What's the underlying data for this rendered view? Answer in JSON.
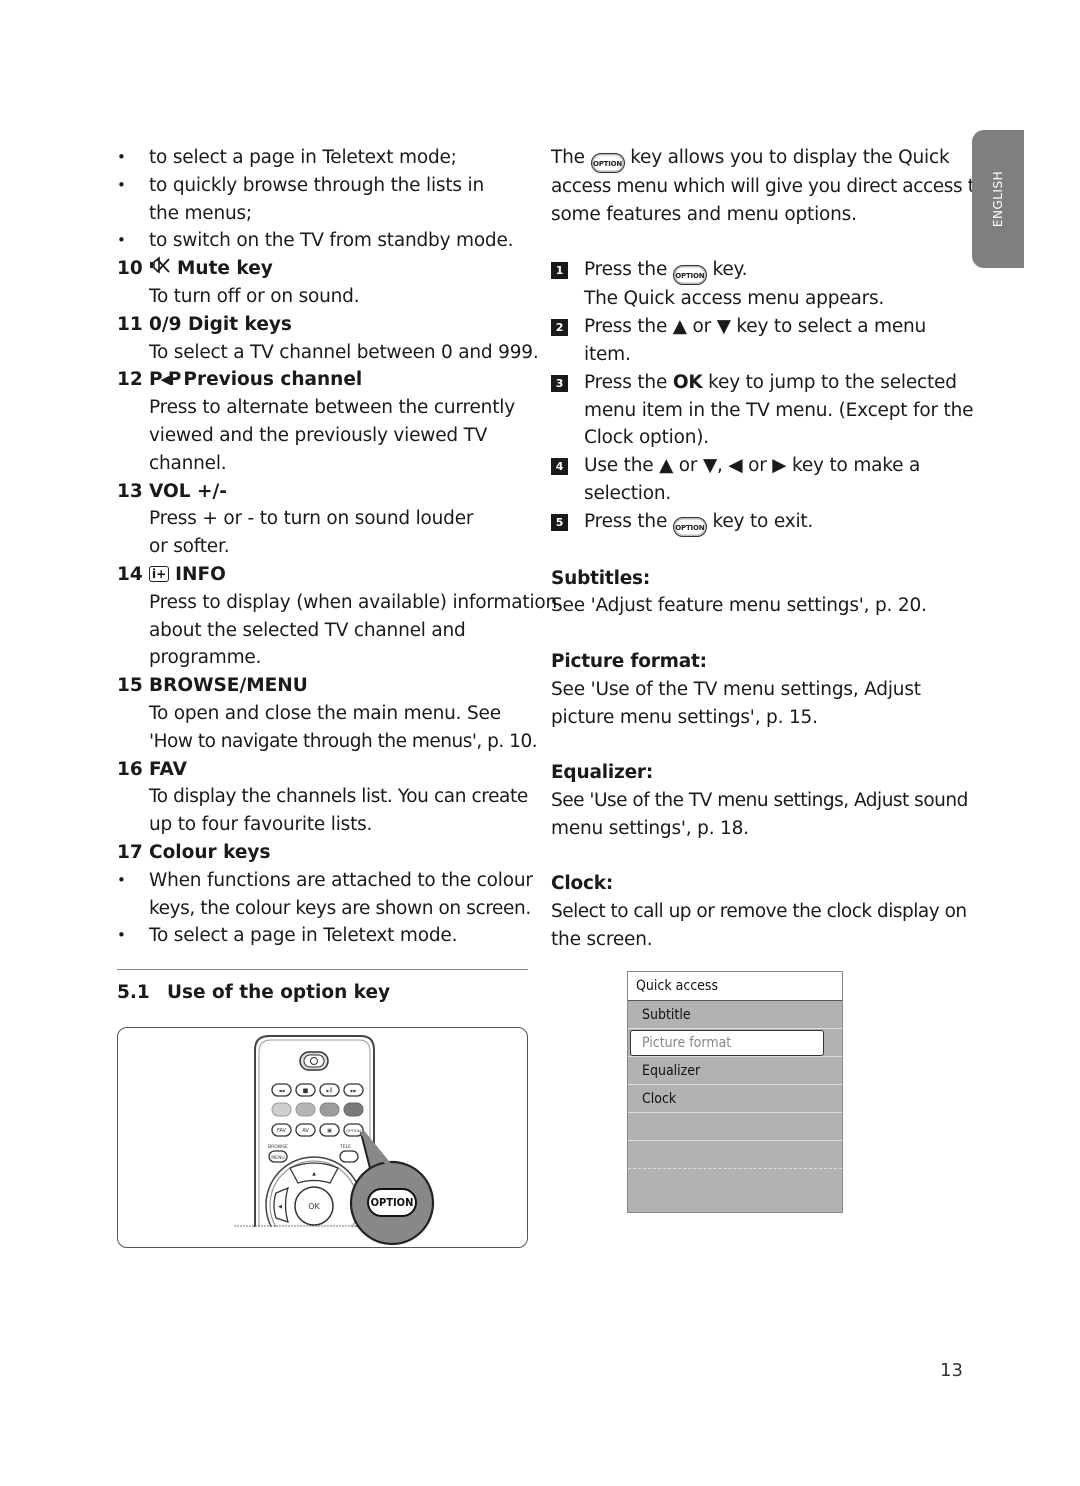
{
  "left_column": {
    "bullets_top": [
      "to select a page in Teletext mode;",
      "to quickly browse through the lists in",
      "the menus;",
      "to switch on the TV from standby mode."
    ],
    "items": [
      {
        "num": "10",
        "icon": "mute-icon",
        "title": "Mute key",
        "lines": [
          "To turn off or on sound."
        ]
      },
      {
        "num": "11",
        "title": "0/9 Digit keys",
        "lines": [
          "To select a TV channel between 0 and 999."
        ]
      },
      {
        "num": "12",
        "icon": "previous-channel-icon",
        "icon_text": "P◂P",
        "title": "Previous channel",
        "lines": [
          "Press to alternate between the currently",
          "viewed and the previously viewed TV",
          "channel."
        ]
      },
      {
        "num": "13",
        "title": "VOL +/-",
        "lines": [
          "Press + or - to turn on sound louder",
          "or softer."
        ]
      },
      {
        "num": "14",
        "icon": "info-icon",
        "icon_text": "i+",
        "title": "INFO",
        "lines": [
          "Press to display (when available) information",
          "about the selected TV channel and",
          "programme."
        ]
      },
      {
        "num": "15",
        "title": "BROWSE/MENU",
        "lines": [
          "To open and close the main menu. See",
          "'How to navigate through the menus', p. 10."
        ]
      },
      {
        "num": "16",
        "title": "FAV",
        "lines": [
          "To display the channels list. You can create",
          "up to four favourite lists."
        ]
      },
      {
        "num": "17",
        "title": "Colour keys"
      }
    ],
    "bullets_bottom": [
      "When functions are attached to the colour",
      "keys, the colour keys are shown on screen.",
      "To select a page in Teletext mode."
    ],
    "section": {
      "num": "5.1",
      "title": "Use of the option key"
    },
    "illustration": {
      "callout_label": "OPTION",
      "remote_labels": {
        "browse": "BROWSE",
        "menu": "MENU",
        "tele": "TELE",
        "ok": "OK",
        "fav": "FAV",
        "av": "AV",
        "option_small": "OPTION"
      }
    }
  },
  "right_column": {
    "intro": {
      "prefix": "The",
      "key_label": "OPTION",
      "line1_suffix": "key allows you to display the Quick",
      "line2": "access menu which will give you direct access to",
      "line3": "some features and menu options."
    },
    "steps": [
      {
        "num": "1",
        "line1_prefix": "Press the",
        "key_label": "OPTION",
        "line1_suffix": "key.",
        "line2": "The Quick access menu appears."
      },
      {
        "num": "2",
        "line1": "Press the ▲ or ▼ key to select a menu",
        "line2": "item."
      },
      {
        "num": "3",
        "line1_prefix": "Press the ",
        "bold": "OK",
        "line1_suffix": " key to jump to the selected",
        "line2": "menu item in the TV menu. (Except for the",
        "line3": "Clock option)."
      },
      {
        "num": "4",
        "line1": "Use the ▲ or ▼, ◀ or ▶ key to make a",
        "line2": "selection."
      },
      {
        "num": "5",
        "line1_prefix": "Press the",
        "key_label": "OPTION",
        "line1_suffix": "key to exit."
      }
    ],
    "sections": [
      {
        "title": "Subtitles:",
        "lines": [
          "See 'Adjust feature menu settings', p. 20."
        ]
      },
      {
        "title": "Picture format:",
        "lines": [
          "See 'Use of the TV menu settings, Adjust",
          "picture menu settings', p. 15."
        ]
      },
      {
        "title": "Equalizer:",
        "lines": [
          "See 'Use of the TV menu settings, Adjust sound",
          "menu settings', p. 18."
        ]
      },
      {
        "title": "Clock:",
        "lines": [
          "Select to call up or remove the clock display on",
          "the screen."
        ]
      }
    ],
    "quick_access_menu": {
      "title": "Quick access",
      "items": [
        "Subtitle",
        "Picture format",
        "Equalizer",
        "Clock",
        "",
        "",
        ""
      ],
      "selected": "Picture format"
    }
  },
  "language_tab": "ENGLISH",
  "page_number": "13"
}
